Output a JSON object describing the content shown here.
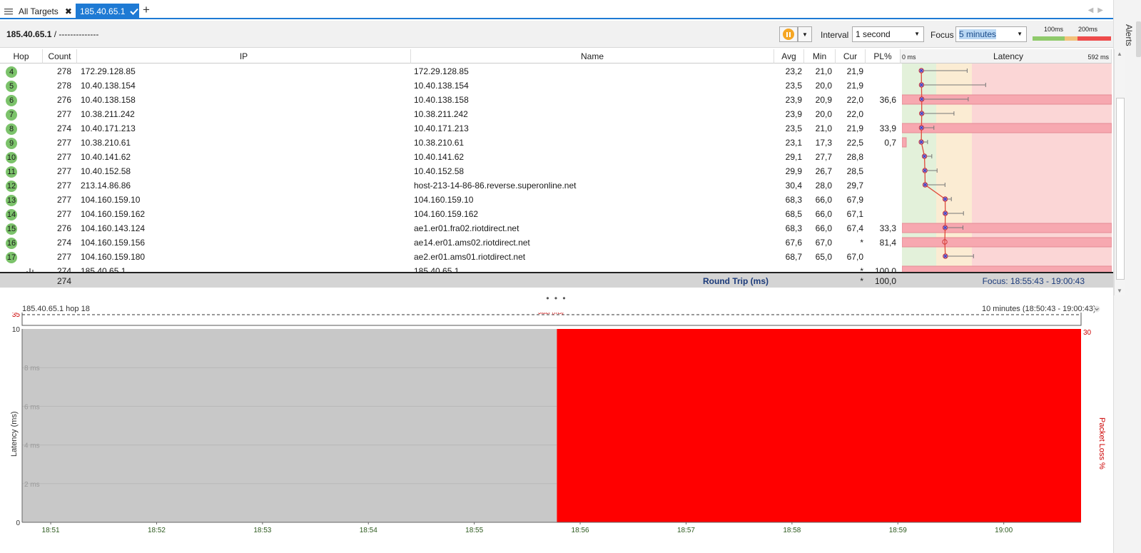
{
  "tabs": {
    "all_targets": "All Targets",
    "active": "185.40.65.1"
  },
  "toolbar": {
    "target_ip": "185.40.65.1",
    "target_suffix": " /  --------------",
    "interval_label": "Interval",
    "interval_value": "1 second",
    "focus_label": "Focus",
    "focus_value": "5 minutes",
    "legend_100": "100ms",
    "legend_200": "200ms"
  },
  "alerts_label": "Alerts",
  "columns": {
    "hop": "Hop",
    "count": "Count",
    "ip": "IP",
    "name": "Name",
    "avg": "Avg",
    "min": "Min",
    "cur": "Cur",
    "pl": "PL%",
    "latency_min": "0 ms",
    "latency": "Latency",
    "latency_max": "592 ms"
  },
  "rows": [
    {
      "hop": "4",
      "count": "278",
      "ip": "172.29.128.85",
      "name": "172.29.128.85",
      "avg": "23,2",
      "min": "21,0",
      "cur": "21,9",
      "pl": "",
      "avg_ms": 23.2,
      "max_ms": 110,
      "loss": false
    },
    {
      "hop": "5",
      "count": "278",
      "ip": "10.40.138.154",
      "name": "10.40.138.154",
      "avg": "23,5",
      "min": "20,0",
      "cur": "21,9",
      "pl": "",
      "avg_ms": 23.5,
      "max_ms": 145,
      "loss": false
    },
    {
      "hop": "6",
      "count": "276",
      "ip": "10.40.138.158",
      "name": "10.40.138.158",
      "avg": "23,9",
      "min": "20,9",
      "cur": "22,0",
      "pl": "36,6",
      "avg_ms": 23.9,
      "max_ms": 112,
      "loss": true
    },
    {
      "hop": "7",
      "count": "277",
      "ip": "10.38.211.242",
      "name": "10.38.211.242",
      "avg": "23,9",
      "min": "20,0",
      "cur": "22,0",
      "pl": "",
      "avg_ms": 23.9,
      "max_ms": 85,
      "loss": false
    },
    {
      "hop": "8",
      "count": "274",
      "ip": "10.40.171.213",
      "name": "10.40.171.213",
      "avg": "23,5",
      "min": "21,0",
      "cur": "21,9",
      "pl": "33,9",
      "avg_ms": 23.5,
      "max_ms": 47,
      "loss": true
    },
    {
      "hop": "9",
      "count": "277",
      "ip": "10.38.210.61",
      "name": "10.38.210.61",
      "avg": "23,1",
      "min": "17,3",
      "cur": "22,5",
      "pl": "0,7",
      "avg_ms": 23.1,
      "max_ms": 35,
      "loss": false,
      "small_loss": true
    },
    {
      "hop": "10",
      "count": "277",
      "ip": "10.40.141.62",
      "name": "10.40.141.62",
      "avg": "29,1",
      "min": "27,7",
      "cur": "28,8",
      "pl": "",
      "avg_ms": 29.1,
      "max_ms": 43,
      "loss": false
    },
    {
      "hop": "11",
      "count": "277",
      "ip": "10.40.152.58",
      "name": "10.40.152.58",
      "avg": "29,9",
      "min": "26,7",
      "cur": "28,5",
      "pl": "",
      "avg_ms": 29.9,
      "max_ms": 53,
      "loss": false
    },
    {
      "hop": "12",
      "count": "277",
      "ip": "213.14.86.86",
      "name": "host-213-14-86-86.reverse.superonline.net",
      "avg": "30,4",
      "min": "28,0",
      "cur": "29,7",
      "pl": "",
      "avg_ms": 30.4,
      "max_ms": 68,
      "loss": false
    },
    {
      "hop": "13",
      "count": "277",
      "ip": "104.160.159.10",
      "name": "104.160.159.10",
      "avg": "68,3",
      "min": "66,0",
      "cur": "67,9",
      "pl": "",
      "avg_ms": 68.3,
      "max_ms": 80,
      "loss": false
    },
    {
      "hop": "14",
      "count": "277",
      "ip": "104.160.159.162",
      "name": "104.160.159.162",
      "avg": "68,5",
      "min": "66,0",
      "cur": "67,1",
      "pl": "",
      "avg_ms": 68.5,
      "max_ms": 103,
      "loss": false
    },
    {
      "hop": "15",
      "count": "276",
      "ip": "104.160.143.124",
      "name": "ae1.er01.fra02.riotdirect.net",
      "avg": "68,3",
      "min": "66,0",
      "cur": "67,4",
      "pl": "33,3",
      "avg_ms": 68.3,
      "max_ms": 102,
      "loss": true
    },
    {
      "hop": "16",
      "count": "274",
      "ip": "104.160.159.156",
      "name": "ae14.er01.ams02.riotdirect.net",
      "avg": "67,6",
      "min": "67,0",
      "cur": "*",
      "pl": "81,4",
      "avg_ms": 67.6,
      "max_ms": 67.6,
      "loss": true,
      "hollow": true
    },
    {
      "hop": "17",
      "count": "277",
      "ip": "104.160.159.180",
      "name": "ae2.er01.ams01.riotdirect.net",
      "avg": "68,7",
      "min": "65,0",
      "cur": "67,0",
      "pl": "",
      "avg_ms": 68.7,
      "max_ms": 122,
      "loss": false
    },
    {
      "hop": "",
      "count": "274",
      "ip": "185.40.65.1",
      "name": "185.40.65.1",
      "avg": "",
      "min": "",
      "cur": "*",
      "pl": "100,0",
      "loss": true,
      "no_point": true
    }
  ],
  "totals": {
    "count": "274",
    "label": "Round Trip (ms)",
    "cur": "*",
    "pl": "100,0",
    "focus_range": "Focus: 18:55:43 - 19:00:43"
  },
  "bottom": {
    "title": "185.40.65.1 hop 18",
    "range": "10 minutes (18:50:43 - 19:00:43)"
  },
  "chart_data": {
    "type": "area",
    "title": "",
    "xlabel": "",
    "ylabel": "Latency (ms)",
    "y2label": "Packet Loss %",
    "jitter_label": "Jitter (ms)",
    "jitter_max": "35",
    "ylim": [
      0,
      10
    ],
    "y_ticks": [
      "0",
      "2 ms",
      "4 ms",
      "6 ms",
      "8 ms",
      "10"
    ],
    "y2_max": "30",
    "x_ticks": [
      "18:51",
      "18:52",
      "18:53",
      "18:54",
      "18:55",
      "18:56",
      "18:57",
      "18:58",
      "18:59",
      "19:00"
    ],
    "x_range_minutes": [
      0,
      10
    ],
    "segments": [
      {
        "state": "no data",
        "start_min": 0,
        "end_min": 5.05,
        "color": "#c8c8c8"
      },
      {
        "state": "100% packet loss",
        "start_min": 5.05,
        "end_min": 10,
        "color": "#ff0000"
      }
    ]
  },
  "colors": {
    "accent": "#1e7ad4",
    "hop_badge": "#7cc36b",
    "loss_row": "#f7a8b0",
    "zone_green": "#e3f1da",
    "zone_yellow": "#fbecd3",
    "zone_red": "#fbd6d6"
  }
}
